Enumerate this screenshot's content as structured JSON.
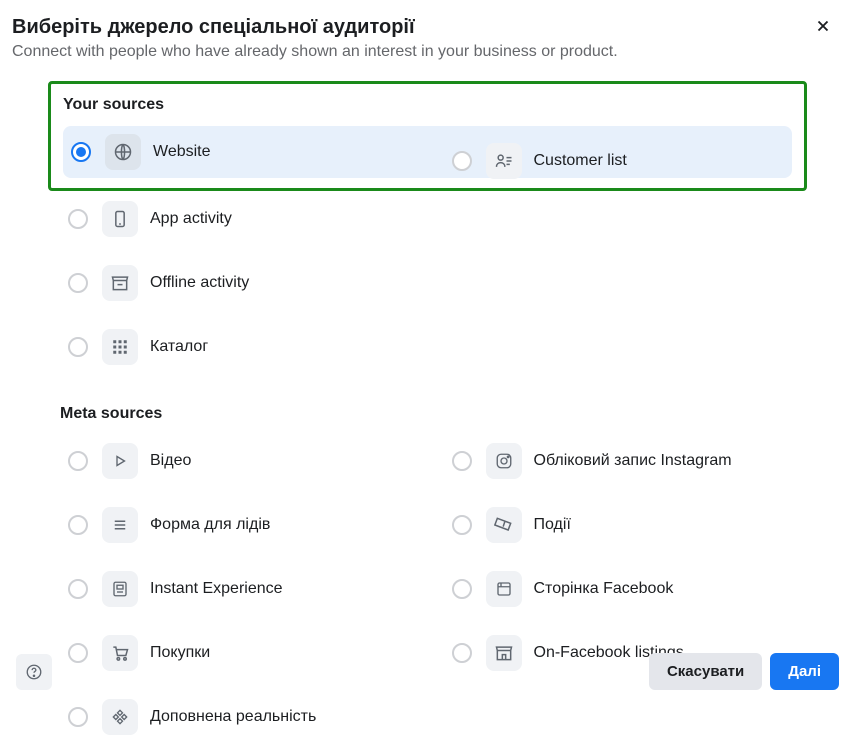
{
  "header": {
    "title": "Виберіть джерело спеціальної аудиторії",
    "subtitle": "Connect with people who have already shown an interest in your business or product."
  },
  "sections": {
    "your_sources": {
      "title": "Your sources",
      "items": [
        {
          "label": "Website",
          "selected": true
        },
        {
          "label": "Customer list",
          "selected": false
        },
        {
          "label": "App activity",
          "selected": false
        },
        {
          "label": "Offline activity",
          "selected": false
        },
        {
          "label": "Каталог",
          "selected": false
        }
      ]
    },
    "meta_sources": {
      "title": "Meta sources",
      "items": [
        {
          "label": "Відео",
          "selected": false
        },
        {
          "label": "Обліковий запис Instagram",
          "selected": false
        },
        {
          "label": "Форма для лідів",
          "selected": false
        },
        {
          "label": "Події",
          "selected": false
        },
        {
          "label": "Instant Experience",
          "selected": false
        },
        {
          "label": "Сторінка Facebook",
          "selected": false
        },
        {
          "label": "Покупки",
          "selected": false
        },
        {
          "label": "On-Facebook listings",
          "selected": false
        },
        {
          "label": "Доповнена реальність",
          "selected": false
        }
      ]
    }
  },
  "footer": {
    "cancel": "Скасувати",
    "next": "Далі"
  }
}
